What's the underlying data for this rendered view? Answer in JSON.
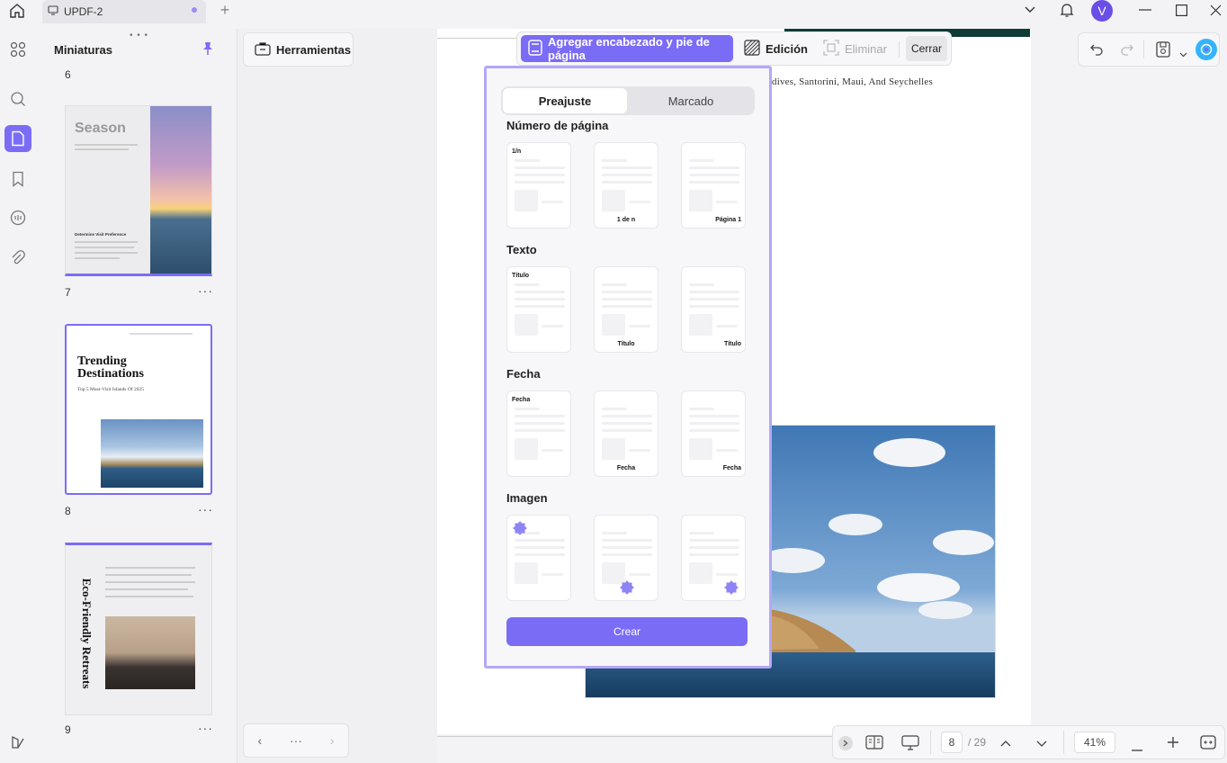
{
  "window": {
    "tab_title": "UPDF-2",
    "avatar_letter": "V"
  },
  "thumbnails": {
    "title": "Miniaturas",
    "top_partial_number": "6",
    "pages": [
      {
        "number": "7",
        "heading": "Season",
        "subheading": "Determine Visit Preference"
      },
      {
        "number": "8",
        "heading_line1": "Trending",
        "heading_line2": "Destinations",
        "subheading": "Top 5 Must-Visit Islands Of 2025"
      },
      {
        "number": "9",
        "heading": "Eco-Friendly Retreats"
      }
    ]
  },
  "tools": {
    "label": "Herramientas"
  },
  "document": {
    "text_line": "dives, Santorini, Maui, And  Seychelles"
  },
  "header_footer_toolbar": {
    "active_label": "Agregar encabezado y pie de página",
    "edit_label": "Edición",
    "delete_label": "Eliminar",
    "close_label": "Cerrar"
  },
  "preset_panel": {
    "tabs": [
      "Preajuste",
      "Marcado"
    ],
    "sections": [
      {
        "title": "Número de página",
        "cards": [
          {
            "label": "1/n",
            "pos": "top"
          },
          {
            "label": "1 de n",
            "pos": "center"
          },
          {
            "label": "Página 1",
            "pos": "right"
          }
        ]
      },
      {
        "title": "Texto",
        "cards": [
          {
            "label": "Título",
            "pos": "top"
          },
          {
            "label": "Título",
            "pos": "center"
          },
          {
            "label": "Título",
            "pos": "right"
          }
        ]
      },
      {
        "title": "Fecha",
        "cards": [
          {
            "label": "Fecha",
            "pos": "top"
          },
          {
            "label": "Fecha",
            "pos": "center"
          },
          {
            "label": "Fecha",
            "pos": "right"
          }
        ]
      },
      {
        "title": "Imagen",
        "cards": [
          {
            "label": "",
            "pos": "top-image"
          },
          {
            "label": "",
            "pos": "center-image"
          },
          {
            "label": "",
            "pos": "right-image"
          }
        ]
      }
    ],
    "create_label": "Crear"
  },
  "zoombar": {
    "current_page": "8",
    "total_pages": "/ 29",
    "zoom": "41%"
  },
  "colors": {
    "accent": "#7b6cf6",
    "popup_border": "#b3a8f6",
    "doc_header_bar": "#0f3b36"
  }
}
